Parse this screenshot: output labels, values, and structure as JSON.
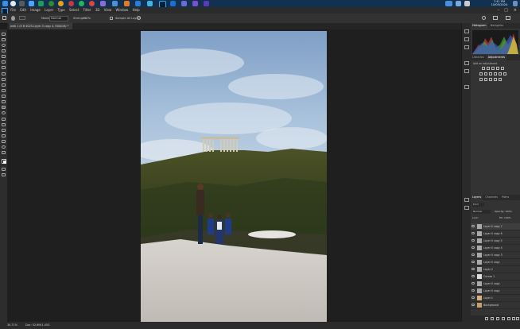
{
  "taskbar": {
    "clock_time": "7:41 PM",
    "clock_date": "10/05/2024"
  },
  "menu": [
    "File",
    "Edit",
    "Image",
    "Layer",
    "Type",
    "Select",
    "Filter",
    "3D",
    "View",
    "Window",
    "Help"
  ],
  "options": {
    "mode_label": "Mode:",
    "mode_value": "Normal",
    "strength_label": "Strength:",
    "strength_value": "50%",
    "sample_all_layers": "Sample All Layers"
  },
  "document": {
    "tab_title": "web 1 (E B 4025-Layer 0 copy 4, RGB/16) *"
  },
  "panels": {
    "navigator_tab": "Navigator",
    "histogram_tab": "Histogram",
    "libraries_tab": "Libraries",
    "adjustments_tab": "Adjustments",
    "add_adjustment": "Add an adjustment",
    "layers_tab": "Layers",
    "channels_tab": "Channels",
    "paths_tab": "Paths",
    "kind_label": "Kind",
    "blend_mode": "Normal",
    "opacity_label": "Opacity:",
    "opacity_value": "100%",
    "fill_label": "Fill:",
    "fill_value": "100%",
    "lock_label": "Lock:"
  },
  "layers": [
    {
      "name": "Layer 0 copy 7"
    },
    {
      "name": "Layer 0 copy 6"
    },
    {
      "name": "Layer 0 copy 5"
    },
    {
      "name": "Layer 0 copy 4"
    },
    {
      "name": "Layer 0 copy 3"
    },
    {
      "name": "Layer 0 copy"
    },
    {
      "name": "Layer 2"
    },
    {
      "name": "Curves 1"
    },
    {
      "name": "Layer 0 copy"
    },
    {
      "name": "Layer 0 copy"
    },
    {
      "name": "Layer 1"
    },
    {
      "name": "Background"
    }
  ],
  "status": {
    "zoom": "34.71%",
    "doc_size": "Doc: 52.6M/1.45G"
  },
  "colors": {
    "ps_accent": "#31a8ff",
    "taskbar": "#12304f"
  }
}
